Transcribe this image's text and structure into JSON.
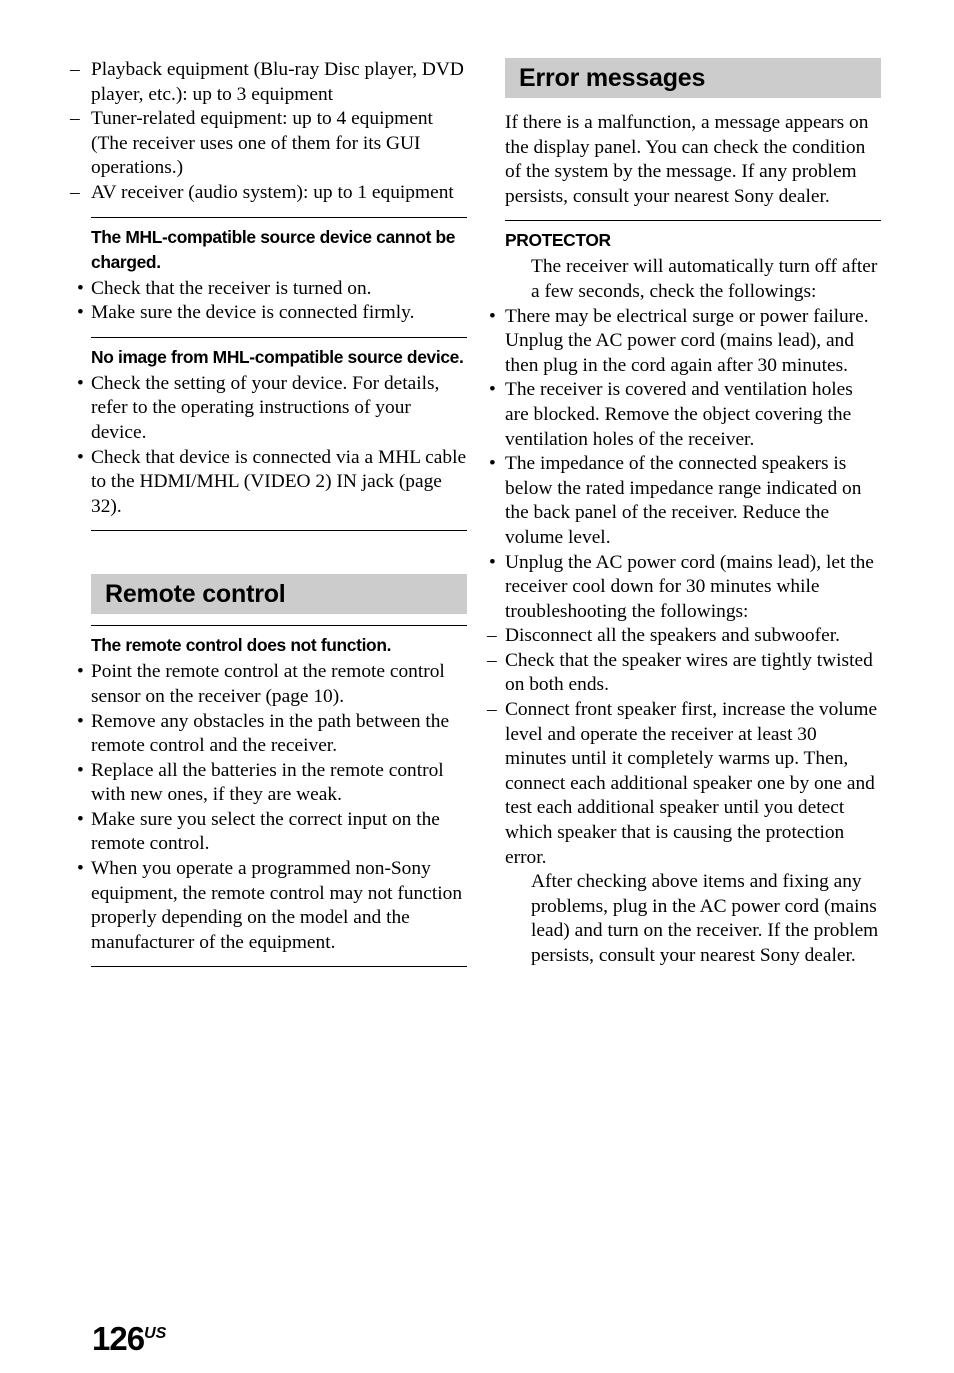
{
  "page": {
    "number": "126",
    "region_suffix": "US",
    "band_color": "#cccccc"
  },
  "left_column": {
    "continued_dash_list": [
      "Playback equipment (Blu-ray Disc player, DVD player, etc.): up to 3 equipment",
      "Tuner-related equipment: up to 4 equipment (The receiver uses one of them for its GUI operations.)",
      "AV receiver (audio system): up to 1 equipment"
    ],
    "topics": [
      {
        "heading": "The MHL-compatible source device cannot be charged.",
        "bullets": [
          "Check that the receiver is turned on.",
          "Make sure the device is connected firmly."
        ]
      },
      {
        "heading": "No image from MHL-compatible source device.",
        "bullets": [
          "Check the setting of your device. For details, refer to the operating instructions of your device.",
          "Check that device is connected via a MHL cable to the HDMI/MHL (VIDEO 2) IN jack (page 32)."
        ]
      }
    ],
    "section": {
      "title": "Remote control",
      "topics": [
        {
          "heading": "The remote control does not function.",
          "bullets": [
            "Point the remote control at the remote control sensor on the receiver (page 10).",
            "Remove any obstacles in the path between the remote control and the receiver.",
            "Replace all the batteries in the remote control with new ones, if they are weak.",
            "Make sure you select the correct input on the remote control.",
            "When you operate a programmed non-Sony equipment, the remote control may not function properly depending on the model and the manufacturer of the equipment."
          ]
        }
      ]
    }
  },
  "right_column": {
    "section": {
      "title": "Error messages",
      "intro": "If there is a malfunction, a message appears on the display panel. You can check the condition of the system by the message. If any problem persists, consult your nearest Sony dealer."
    },
    "entry": {
      "heading": "PROTECTOR",
      "intro": "The receiver will automatically turn off after a few seconds, check the followings:",
      "bullets": [
        {
          "text": "There may be electrical surge or power failure. Unplug the AC power cord (mains lead), and then plug in the cord again after 30 minutes."
        },
        {
          "text": "The receiver is covered and ventilation holes are blocked. Remove the object covering the ventilation holes of the receiver."
        },
        {
          "text": "The impedance of the connected speakers is below the rated impedance range indicated on the back panel of the receiver. Reduce the volume level."
        },
        {
          "text": "Unplug the AC power cord (mains lead), let the receiver cool down for 30 minutes while troubleshooting the followings:",
          "sub_dashes": [
            "Disconnect all the speakers and subwoofer.",
            "Check that the speaker wires are tightly twisted on both ends.",
            "Connect front speaker first, increase the volume level and operate the receiver at least 30 minutes until it completely warms up. Then, connect each additional speaker one by one and test each additional speaker until you detect which speaker that is causing the protection error."
          ]
        }
      ],
      "outro": "After checking above items and fixing any problems, plug in the AC power cord (mains lead) and turn on the receiver. If the problem persists, consult your nearest Sony dealer."
    }
  }
}
